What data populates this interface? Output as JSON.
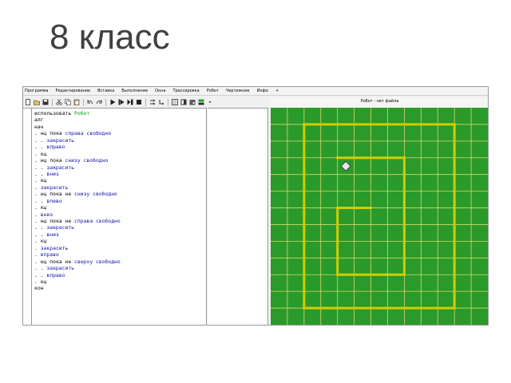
{
  "slide": {
    "title": "8 класс"
  },
  "window": {
    "menu": [
      "Программа",
      "Редактирование",
      "Вставка",
      "Выполнение",
      "Окна",
      "Трассировка",
      "Робот",
      "Чертежник",
      "Инфо",
      "+"
    ],
    "toolbar_icons": [
      "new-file-icon",
      "open-file-icon",
      "save-icon",
      "cut-icon",
      "copy-icon",
      "paste-icon",
      "undo-icon",
      "redo-icon",
      "run-icon",
      "run-step-icon",
      "pause-icon",
      "stop-icon",
      "step-over-icon",
      "step-into-icon",
      "layout-single-icon",
      "layout-split-icon",
      "robot-icon",
      "drawer-icon",
      "more-icon"
    ]
  },
  "code": {
    "lines": [
      [
        {
          "t": "использовать ",
          "c": "kw"
        },
        {
          "t": "Робот",
          "c": "green"
        }
      ],
      [
        {
          "t": "алг",
          "c": "kw"
        }
      ],
      [
        {
          "t": "нач",
          "c": "kw"
        }
      ],
      [
        {
          "t": ". ",
          "c": "dot"
        },
        {
          "t": "нц пока ",
          "c": "kw"
        },
        {
          "t": "справа свободно",
          "c": "blue"
        }
      ],
      [
        {
          "t": ". . ",
          "c": "dot"
        },
        {
          "t": "закрасить",
          "c": "blue"
        }
      ],
      [
        {
          "t": ". . ",
          "c": "dot"
        },
        {
          "t": "вправо",
          "c": "blue"
        }
      ],
      [
        {
          "t": ". ",
          "c": "dot"
        },
        {
          "t": "кц",
          "c": "kw"
        }
      ],
      [
        {
          "t": ". ",
          "c": "dot"
        },
        {
          "t": "нц пока ",
          "c": "kw"
        },
        {
          "t": "снизу свободно",
          "c": "blue"
        }
      ],
      [
        {
          "t": ". . ",
          "c": "dot"
        },
        {
          "t": "закрасить",
          "c": "blue"
        }
      ],
      [
        {
          "t": ". . ",
          "c": "dot"
        },
        {
          "t": "вниз",
          "c": "blue"
        }
      ],
      [
        {
          "t": ". ",
          "c": "dot"
        },
        {
          "t": "кц",
          "c": "kw"
        }
      ],
      [
        {
          "t": ". ",
          "c": "dot"
        },
        {
          "t": "закрасить",
          "c": "blue"
        }
      ],
      [
        {
          "t": ". ",
          "c": "dot"
        },
        {
          "t": "нц пока не ",
          "c": "kw"
        },
        {
          "t": "снизу свободно",
          "c": "blue"
        }
      ],
      [
        {
          "t": ". . ",
          "c": "dot"
        },
        {
          "t": "влево",
          "c": "blue"
        }
      ],
      [
        {
          "t": ". ",
          "c": "dot"
        },
        {
          "t": "кц",
          "c": "kw"
        }
      ],
      [
        {
          "t": ". ",
          "c": "dot"
        },
        {
          "t": "вниз",
          "c": "blue"
        }
      ],
      [
        {
          "t": ". ",
          "c": "dot"
        },
        {
          "t": "нц пока не ",
          "c": "kw"
        },
        {
          "t": "справа свободно",
          "c": "blue"
        }
      ],
      [
        {
          "t": ". . ",
          "c": "dot"
        },
        {
          "t": "закрасить",
          "c": "blue"
        }
      ],
      [
        {
          "t": ". . ",
          "c": "dot"
        },
        {
          "t": "вниз",
          "c": "blue"
        }
      ],
      [
        {
          "t": ". ",
          "c": "dot"
        },
        {
          "t": "кц",
          "c": "kw"
        }
      ],
      [
        {
          "t": ". ",
          "c": "dot"
        },
        {
          "t": "закрасить",
          "c": "blue"
        }
      ],
      [
        {
          "t": ". ",
          "c": "dot"
        },
        {
          "t": "вправо",
          "c": "blue"
        }
      ],
      [
        {
          "t": ". ",
          "c": "dot"
        },
        {
          "t": "нц пока не ",
          "c": "kw"
        },
        {
          "t": "сверху свободно",
          "c": "blue"
        }
      ],
      [
        {
          "t": ". . ",
          "c": "dot"
        },
        {
          "t": "закрасить",
          "c": "blue"
        }
      ],
      [
        {
          "t": ". . ",
          "c": "dot"
        },
        {
          "t": "вправо",
          "c": "blue"
        }
      ],
      [
        {
          "t": ". ",
          "c": "dot"
        },
        {
          "t": "кц",
          "c": "kw"
        }
      ],
      [
        {
          "t": "кон",
          "c": "kw"
        }
      ]
    ]
  },
  "robot": {
    "title": "Робот - нет файла",
    "colors": {
      "field": "#2a9a2a",
      "grid": "#d8d870",
      "wall": "#d4cc00",
      "robot": "#e8e8e8"
    },
    "grid_cols": 13,
    "grid_rows": 13,
    "robot_cell": {
      "col": 4,
      "row": 3
    },
    "walls": [
      {
        "from": [
          2,
          1
        ],
        "to": [
          11,
          1
        ]
      },
      {
        "from": [
          11,
          1
        ],
        "to": [
          11,
          12
        ]
      },
      {
        "from": [
          11,
          12
        ],
        "to": [
          2,
          12
        ]
      },
      {
        "from": [
          2,
          12
        ],
        "to": [
          2,
          1
        ]
      },
      {
        "from": [
          4,
          3
        ],
        "to": [
          8,
          3
        ]
      },
      {
        "from": [
          8,
          3
        ],
        "to": [
          8,
          10
        ]
      },
      {
        "from": [
          8,
          10
        ],
        "to": [
          4,
          10
        ]
      },
      {
        "from": [
          4,
          10
        ],
        "to": [
          4,
          6
        ]
      },
      {
        "from": [
          4,
          6
        ],
        "to": [
          6,
          6
        ]
      }
    ]
  }
}
